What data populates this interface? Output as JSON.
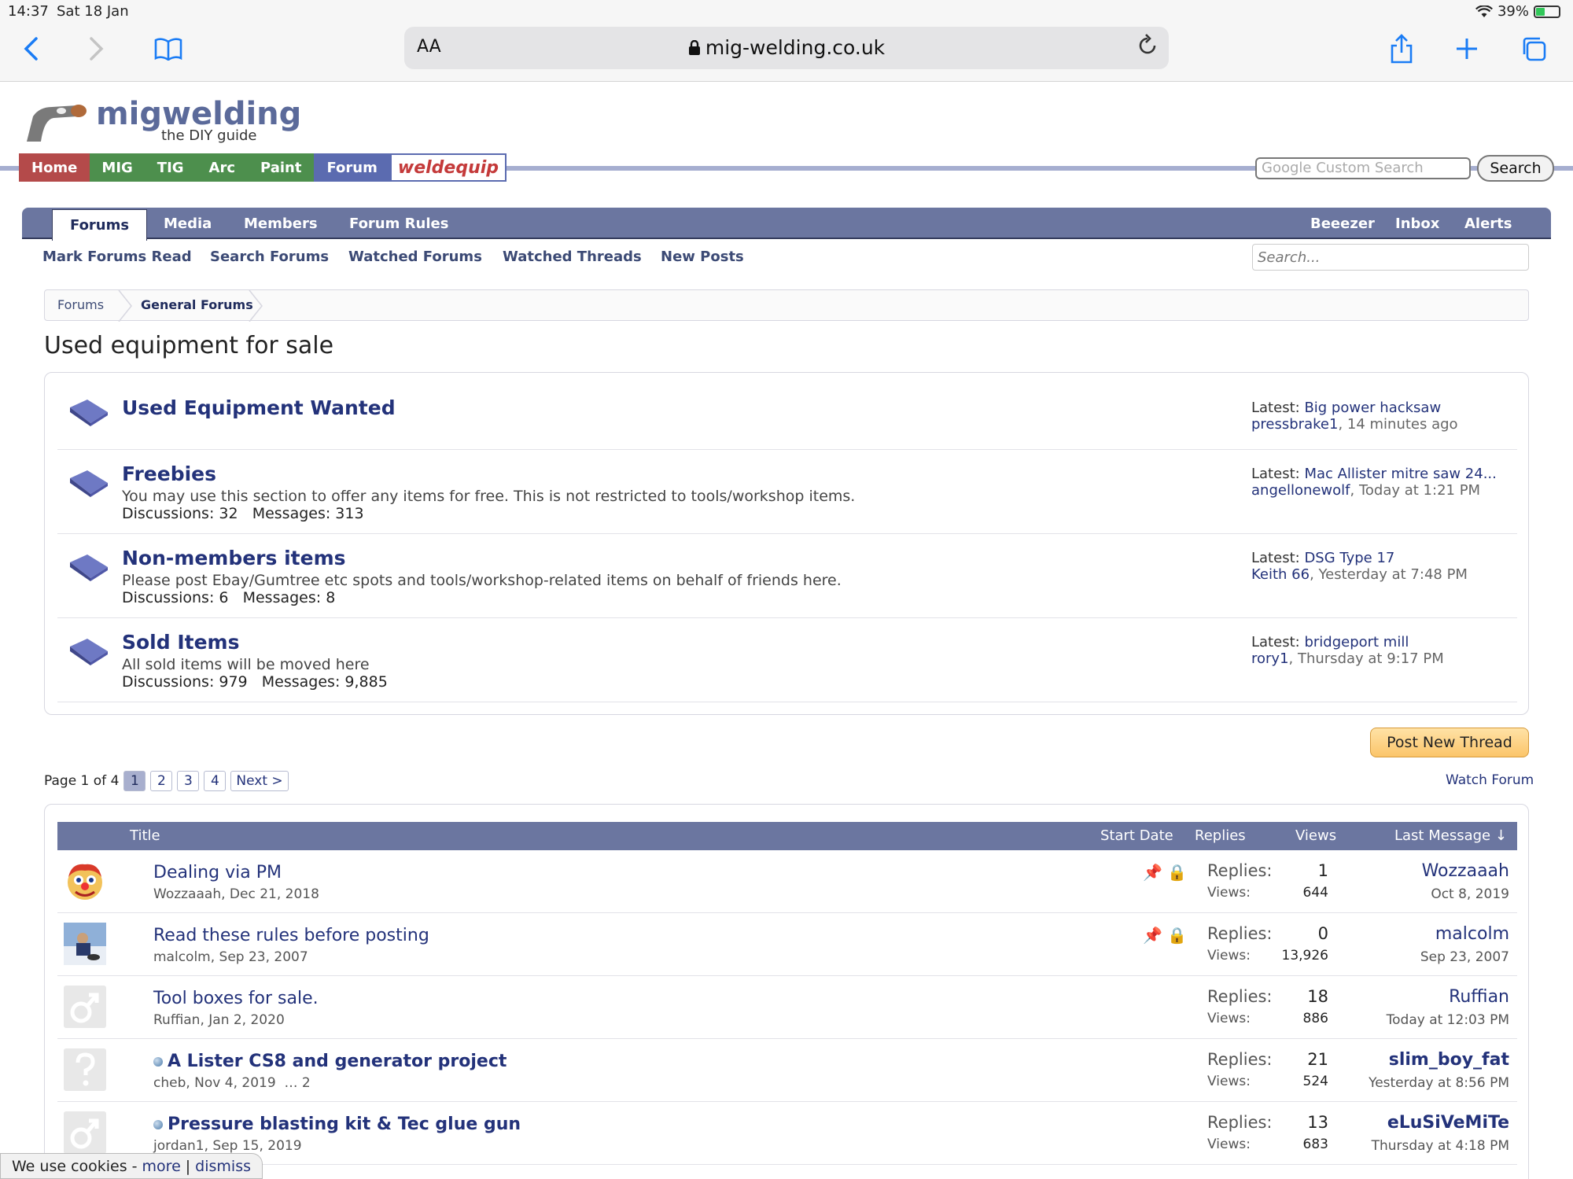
{
  "status_bar": {
    "time": "14:37",
    "date": "Sat 18 Jan",
    "battery": "39%"
  },
  "browser": {
    "text_size_label": "AA",
    "url": "mig-welding.co.uk"
  },
  "site": {
    "logo_main": "migwelding",
    "logo_tagline": "the DIY guide",
    "nav": [
      "Home",
      "MIG",
      "TIG",
      "Arc",
      "Paint",
      "Forum",
      "weldequip"
    ],
    "google_placeholder": "Google Custom Search",
    "search_button": "Search"
  },
  "forum_nav": {
    "tabs": [
      "Forums",
      "Media",
      "Members",
      "Forum Rules"
    ],
    "right": [
      "Beeezer",
      "Inbox",
      "Alerts"
    ],
    "sub": [
      "Mark Forums Read",
      "Search Forums",
      "Watched Forums",
      "Watched Threads",
      "New Posts"
    ],
    "search_placeholder": "Search..."
  },
  "breadcrumb": [
    "Forums",
    "General Forums"
  ],
  "page_title": "Used equipment for sale",
  "subforums": [
    {
      "title": "Used Equipment Wanted",
      "desc": "",
      "discussions": "",
      "messages": "",
      "latest_label": "Latest:",
      "latest_thread": "Big power hacksaw",
      "latest_user": "pressbrake1",
      "latest_time": ", 14 minutes ago"
    },
    {
      "title": "Freebies",
      "desc": "You may use this section to offer any items for free. This is not restricted to tools/workshop items.",
      "discussions": "Discussions: 32",
      "messages": "Messages: 313",
      "latest_label": "Latest:",
      "latest_thread": "Mac Allister mitre saw 24...",
      "latest_user": "angellonewolf",
      "latest_time": ", Today at 1:21 PM"
    },
    {
      "title": "Non-members items",
      "desc": "Please post Ebay/Gumtree etc spots and tools/workshop-related items on behalf of friends here.",
      "discussions": "Discussions: 6",
      "messages": "Messages: 8",
      "latest_label": "Latest:",
      "latest_thread": "DSG Type 17",
      "latest_user": "Keith 66",
      "latest_time": ", Yesterday at 7:48 PM"
    },
    {
      "title": "Sold Items",
      "desc": "All sold items will be moved here",
      "discussions": "Discussions: 979",
      "messages": "Messages: 9,885",
      "latest_label": "Latest:",
      "latest_thread": "bridgeport mill",
      "latest_user": "rory1",
      "latest_time": ", Thursday at 9:17 PM"
    }
  ],
  "actions": {
    "post_new_thread": "Post New Thread",
    "watch_forum": "Watch Forum"
  },
  "pager": {
    "label": "Page 1 of 4",
    "pages": [
      "1",
      "2",
      "3",
      "4"
    ],
    "next": "Next >"
  },
  "table": {
    "headers": {
      "title": "Title",
      "start_date": "Start Date",
      "replies": "Replies",
      "views": "Views",
      "last_message": "Last Message ↓"
    },
    "replies_label": "Replies:",
    "views_label": "Views:",
    "rows": [
      {
        "title": "Dealing via PM",
        "meta": "Wozzaaah, Dec 21, 2018",
        "replies": "1",
        "views": "644",
        "last_user": "Wozzaaah",
        "last_date": "Oct 8, 2019",
        "unread": false,
        "sticky": true
      },
      {
        "title": "Read these rules before posting",
        "meta": "malcolm, Sep 23, 2007",
        "replies": "0",
        "views": "13,926",
        "last_user": "malcolm",
        "last_date": "Sep 23, 2007",
        "unread": false,
        "sticky": true
      },
      {
        "title": "Tool boxes for sale.",
        "meta": "Ruffian, Jan 2, 2020",
        "replies": "18",
        "views": "886",
        "last_user": "Ruffian",
        "last_date": "Today at 12:03 PM",
        "unread": false,
        "sticky": false
      },
      {
        "title": "A Lister CS8 and generator project",
        "meta": "cheb, Nov 4, 2019",
        "meta_pages": "… 2",
        "replies": "21",
        "views": "524",
        "last_user": "slim_boy_fat",
        "last_date": "Yesterday at 8:56 PM",
        "unread": true,
        "sticky": false
      },
      {
        "title": "Pressure blasting kit & Tec glue gun",
        "meta": "jordan1, Sep 15, 2019",
        "replies": "13",
        "views": "683",
        "last_user": "eLuSiVeMiTe",
        "last_date": "Thursday at 4:18 PM",
        "unread": true,
        "sticky": false
      }
    ]
  },
  "cookie": {
    "text": "We use cookies -",
    "more": "more",
    "sep": "|",
    "dismiss": "dismiss"
  },
  "colors": {
    "nav_blue": "#6b76a0",
    "link": "#23327a",
    "home_red": "#b44a4a",
    "green": "#4d8f4d",
    "button_orange": "#fbc56a"
  },
  "icons": [
    "back-icon",
    "forward-icon",
    "bookmarks-icon",
    "lock-icon",
    "reload-icon",
    "share-icon",
    "new-tab-icon",
    "tabs-icon",
    "wifi-icon",
    "battery-icon",
    "forum-book-icon",
    "sticky-pin-icon",
    "locked-icon",
    "unread-dot-icon"
  ]
}
